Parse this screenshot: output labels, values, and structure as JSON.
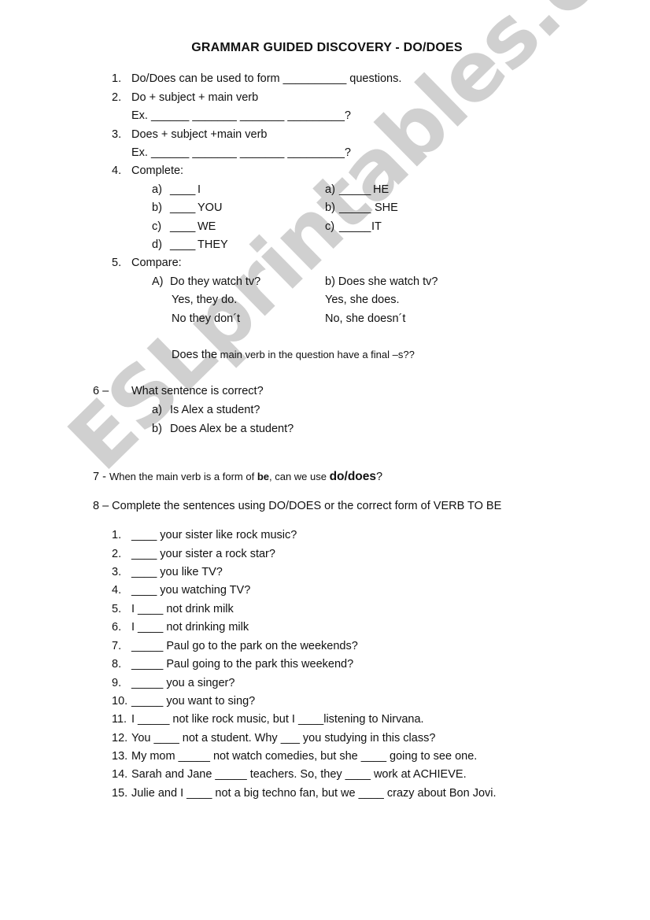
{
  "title": "GRAMMAR GUIDED DISCOVERY - DO/DOES",
  "watermark": {
    "text": "ESLprintables.com",
    "color": "#c8c8c8"
  },
  "part1": {
    "items": [
      {
        "num": "1.",
        "text": "Do/Does can be used to form __________ questions."
      },
      {
        "num": "2.",
        "text": "Do + subject + main verb",
        "example": "Ex. ______ _______ _______ _________?"
      },
      {
        "num": "3.",
        "text": "Does + subject +main verb",
        "example": "Ex. ______ _______ _______ _________?"
      },
      {
        "num": "4.",
        "text": "Complete:"
      }
    ],
    "complete_left": [
      {
        "letter": "a)",
        "blank": "____",
        "word": "I"
      },
      {
        "letter": "b)",
        "blank": "____",
        "word": "YOU"
      },
      {
        "letter": "c)",
        "blank": "____",
        "word": "WE"
      },
      {
        "letter": "d)",
        "blank": "____",
        "word": "THEY"
      }
    ],
    "complete_right": [
      {
        "letter": "a)",
        "blank": "_____",
        "word": "HE"
      },
      {
        "letter": "b)",
        "blank": "_____",
        "word": "SHE"
      },
      {
        "letter": "c)",
        "blank": "_____",
        "word": "IT"
      }
    ],
    "compare": {
      "num": "5.",
      "label": "Compare:",
      "left": {
        "letter": "A)",
        "question": "Do they watch tv?",
        "yes": "Yes, they do.",
        "no": "No they don´t"
      },
      "right": {
        "question": "b) Does she watch tv?",
        "yes": "Yes, she does.",
        "no": "No, she doesn´t"
      },
      "prompt_lead": "Does the",
      "prompt_rest": " main verb in the question have a final –s??"
    }
  },
  "q6": {
    "num": "6 –",
    "question": "What sentence is correct?",
    "options": [
      {
        "letter": "a)",
        "text": "Is Alex a student?"
      },
      {
        "letter": "b)",
        "text": "Does Alex be a student?"
      }
    ]
  },
  "q7": {
    "lead": "7 - ",
    "text1": "When the main verb is a form of ",
    "bold1": "be",
    "text2": ", can we use ",
    "bold2": "do/does",
    "end": "?"
  },
  "q8": {
    "instruction": "8 – Complete the sentences using DO/DOES or the correct form of VERB TO BE",
    "sentences": [
      {
        "num": "1.",
        "text": "____ your sister like rock music?"
      },
      {
        "num": "2.",
        "text": "____ your sister a rock star?"
      },
      {
        "num": "3.",
        "text": "____ you like TV?"
      },
      {
        "num": "4.",
        "text": "____ you watching TV?"
      },
      {
        "num": "5.",
        "text": "I ____ not drink milk"
      },
      {
        "num": "6.",
        "text": "I ____ not drinking milk"
      },
      {
        "num": "7.",
        "text": "_____ Paul go to the park on the weekends?"
      },
      {
        "num": "8.",
        "text": "_____ Paul going to the park this weekend?"
      },
      {
        "num": "9.",
        "text": "_____ you a singer?"
      },
      {
        "num": "10.",
        "text": "_____ you want to sing?"
      },
      {
        "num": "11.",
        "text": "I _____ not like rock music, but I ____listening to Nirvana."
      },
      {
        "num": "12.",
        "text": "You ____ not a student. Why ___ you studying in this class?"
      },
      {
        "num": "13.",
        "text": "My mom _____ not watch comedies, but she ____ going to see one."
      },
      {
        "num": "14.",
        "text": "Sarah and Jane _____ teachers. So, they ____ work at ACHIEVE."
      },
      {
        "num": "15.",
        "text": "Julie and I ____ not a big techno fan, but we ____ crazy about Bon Jovi."
      }
    ]
  }
}
